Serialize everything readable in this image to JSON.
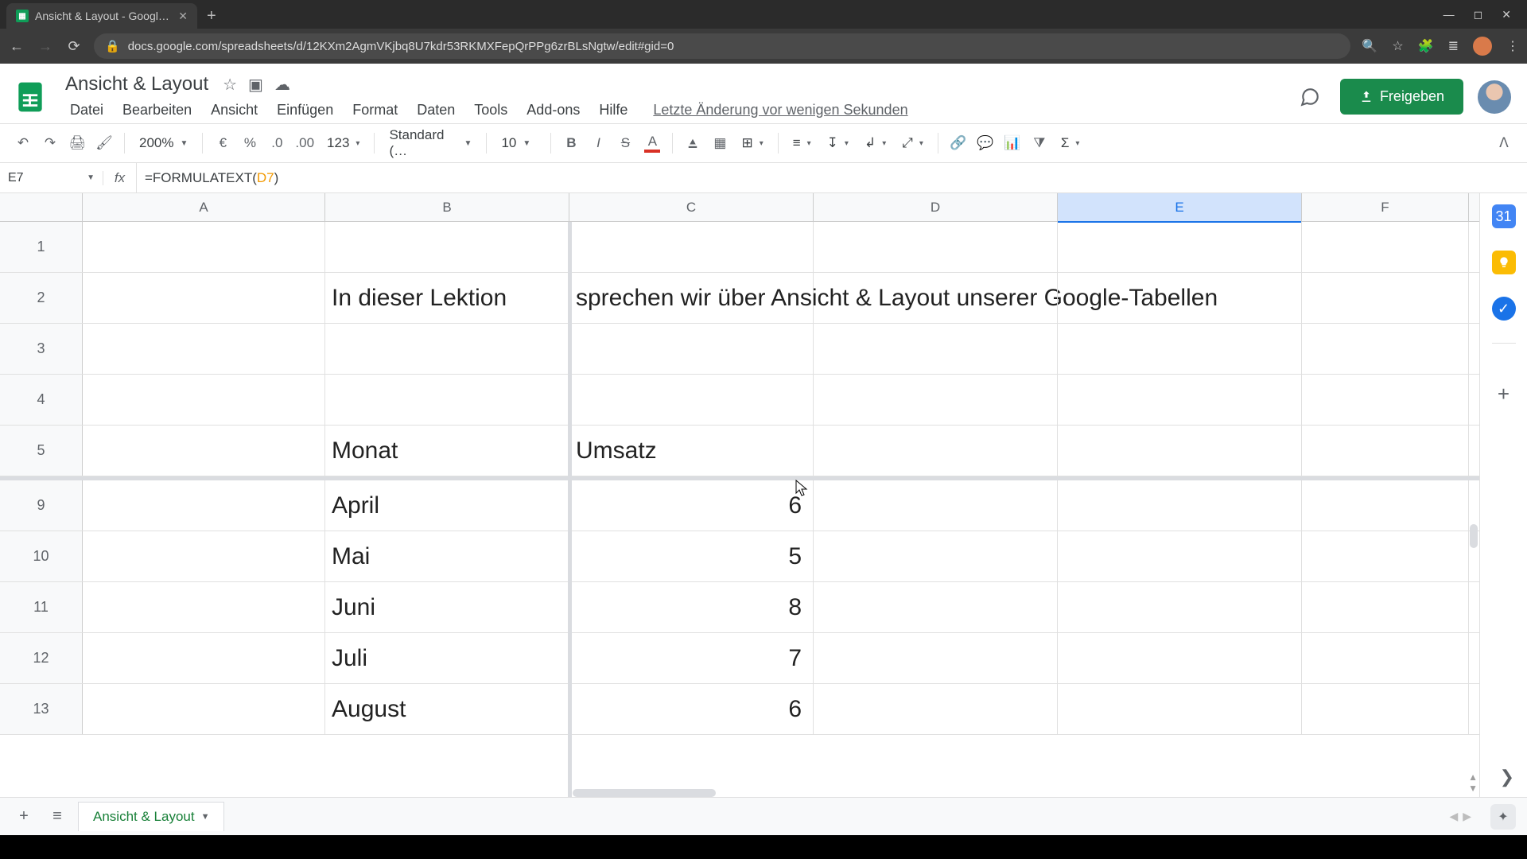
{
  "browser": {
    "tab_title": "Ansicht & Layout - Google Tabel",
    "url": "docs.google.com/spreadsheets/d/12KXm2AgmVKjbq8U7kdr53RKMXFepQrPPg6zrBLsNgtw/edit#gid=0"
  },
  "doc": {
    "title": "Ansicht & Layout",
    "last_change": "Letzte Änderung vor wenigen Sekunden",
    "share_label": "Freigeben"
  },
  "menus": [
    "Datei",
    "Bearbeiten",
    "Ansicht",
    "Einfügen",
    "Format",
    "Daten",
    "Tools",
    "Add-ons",
    "Hilfe"
  ],
  "toolbar": {
    "zoom": "200%",
    "font_family": "Standard (…",
    "font_size": "10",
    "format_number": "123"
  },
  "name_box": "E7",
  "formula": {
    "prefix": "=FORMULATEXT(",
    "ref": "D7",
    "suffix": ")"
  },
  "columns": [
    "A",
    "B",
    "C",
    "D",
    "E",
    "F"
  ],
  "rows": [
    {
      "num": "1",
      "B": "",
      "C": ""
    },
    {
      "num": "2",
      "B": "In dieser Lektion",
      "C": "sprechen wir über Ansicht & Layout unserer Google-Tabellen"
    },
    {
      "num": "3",
      "B": "",
      "C": ""
    },
    {
      "num": "4",
      "B": "",
      "C": ""
    },
    {
      "num": "5",
      "B": "Monat",
      "C": "Umsatz"
    },
    {
      "num": "9",
      "B": "April",
      "C": "6"
    },
    {
      "num": "10",
      "B": "Mai",
      "C": "5"
    },
    {
      "num": "11",
      "B": "Juni",
      "C": "8"
    },
    {
      "num": "12",
      "B": "Juli",
      "C": "7"
    },
    {
      "num": "13",
      "B": "August",
      "C": "6"
    }
  ],
  "selected_column": "E",
  "sheet_tab": "Ansicht & Layout",
  "chart_data": {
    "type": "table",
    "title": "Monat / Umsatz",
    "columns": [
      "Monat",
      "Umsatz"
    ],
    "rows": [
      [
        "April",
        6
      ],
      [
        "Mai",
        5
      ],
      [
        "Juni",
        8
      ],
      [
        "Juli",
        7
      ],
      [
        "August",
        6
      ]
    ]
  }
}
